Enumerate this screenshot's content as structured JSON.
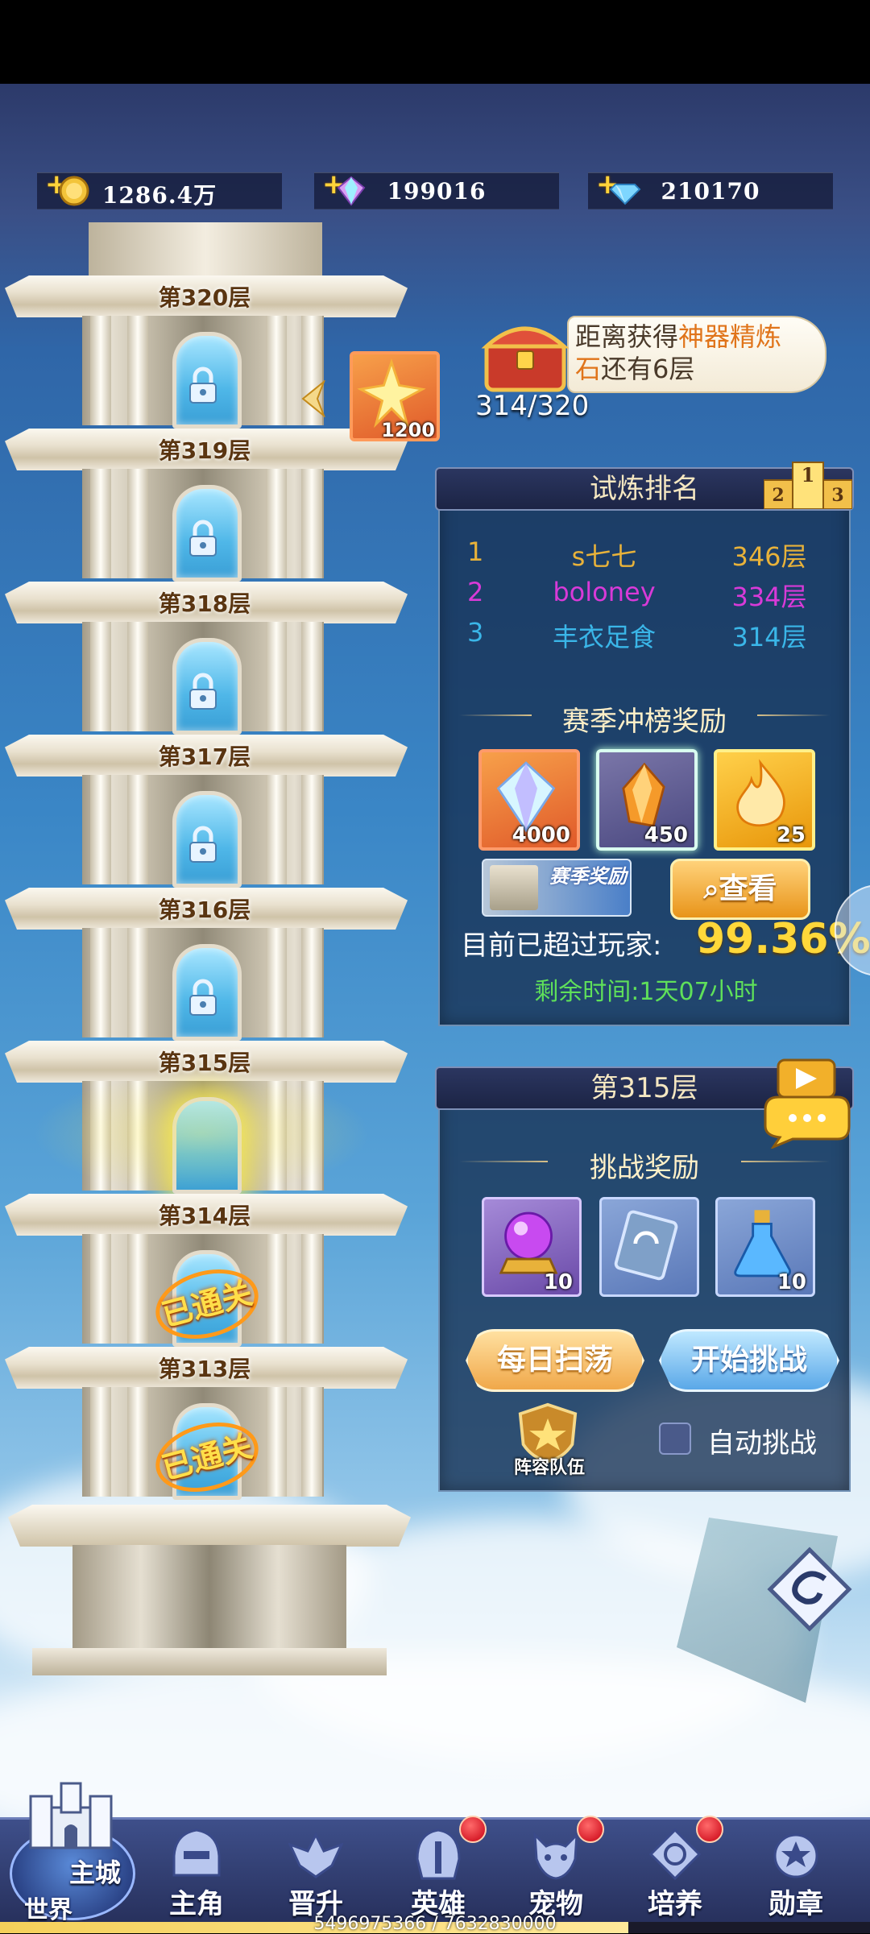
{
  "currencies": [
    {
      "icon": "gold-coin-icon",
      "value": "1286.4万"
    },
    {
      "icon": "rainbow-crystal-icon",
      "value": "199016"
    },
    {
      "icon": "blue-diamond-icon",
      "value": "210170"
    }
  ],
  "tower": {
    "floors": [
      {
        "label": "第320层",
        "state": "locked"
      },
      {
        "label": "第319层",
        "state": "locked"
      },
      {
        "label": "第318层",
        "state": "locked"
      },
      {
        "label": "第317层",
        "state": "locked"
      },
      {
        "label": "第316层",
        "state": "locked"
      },
      {
        "label": "第315层",
        "state": "current"
      },
      {
        "label": "第314层",
        "state": "cleared"
      },
      {
        "label": "第313层",
        "state": "cleared"
      }
    ],
    "cleared_stamp": "已通关",
    "floor_reward_count": "1200"
  },
  "chest": {
    "line1_prefix": "距离获得",
    "highlight_a": "神器精炼",
    "highlight_b": "石",
    "line2_suffix": "还有6层",
    "progress": "314/320"
  },
  "ranking": {
    "title": "试炼排名",
    "rows": [
      {
        "rank": "1",
        "name": "s七七",
        "floor": "346层",
        "color": "#e8b23a"
      },
      {
        "rank": "2",
        "name": "boloney",
        "floor": "334层",
        "color": "#d83ad8"
      },
      {
        "rank": "3",
        "name": "丰衣足食",
        "floor": "314层",
        "color": "#3ab6e8"
      }
    ],
    "season_title": "赛季冲榜奖励",
    "rewards": [
      {
        "icon": "rainbow-diamond-icon",
        "count": "4000"
      },
      {
        "icon": "orange-crystal-icon",
        "count": "450"
      },
      {
        "icon": "flame-essence-icon",
        "count": "25"
      }
    ],
    "season_badge": "赛季奖励",
    "view_button": "查看",
    "surpass_label": "目前已超过玩家:",
    "surpass_value": "99.36%",
    "remaining": "剩余时间:1天07小时"
  },
  "challenge": {
    "title": "第315层",
    "reward_title": "挑战奖励",
    "rewards": [
      {
        "icon": "purple-orb-icon",
        "count": "10"
      },
      {
        "icon": "skill-card-icon",
        "count": ""
      },
      {
        "icon": "blue-potion-icon",
        "count": "10"
      }
    ],
    "sweep_button": "每日扫荡",
    "start_button": "开始挑战",
    "lineup_label": "阵容队伍",
    "auto_label": "自动挑战",
    "auto_checked": false
  },
  "nav": {
    "world_top": "主城",
    "world_bottom": "世界",
    "items": [
      {
        "label": "主角",
        "icon": "hero-helmet-icon",
        "badge": false
      },
      {
        "label": "晋升",
        "icon": "promotion-wings-icon",
        "badge": false
      },
      {
        "label": "英雄",
        "icon": "knight-helmet-icon",
        "badge": true
      },
      {
        "label": "宠物",
        "icon": "pet-beast-icon",
        "badge": true
      },
      {
        "label": "培养",
        "icon": "training-emblem-icon",
        "badge": true
      },
      {
        "label": "勋章",
        "icon": "medal-star-icon",
        "badge": false
      }
    ],
    "footer_text": "5496975366 / 7632830000"
  }
}
